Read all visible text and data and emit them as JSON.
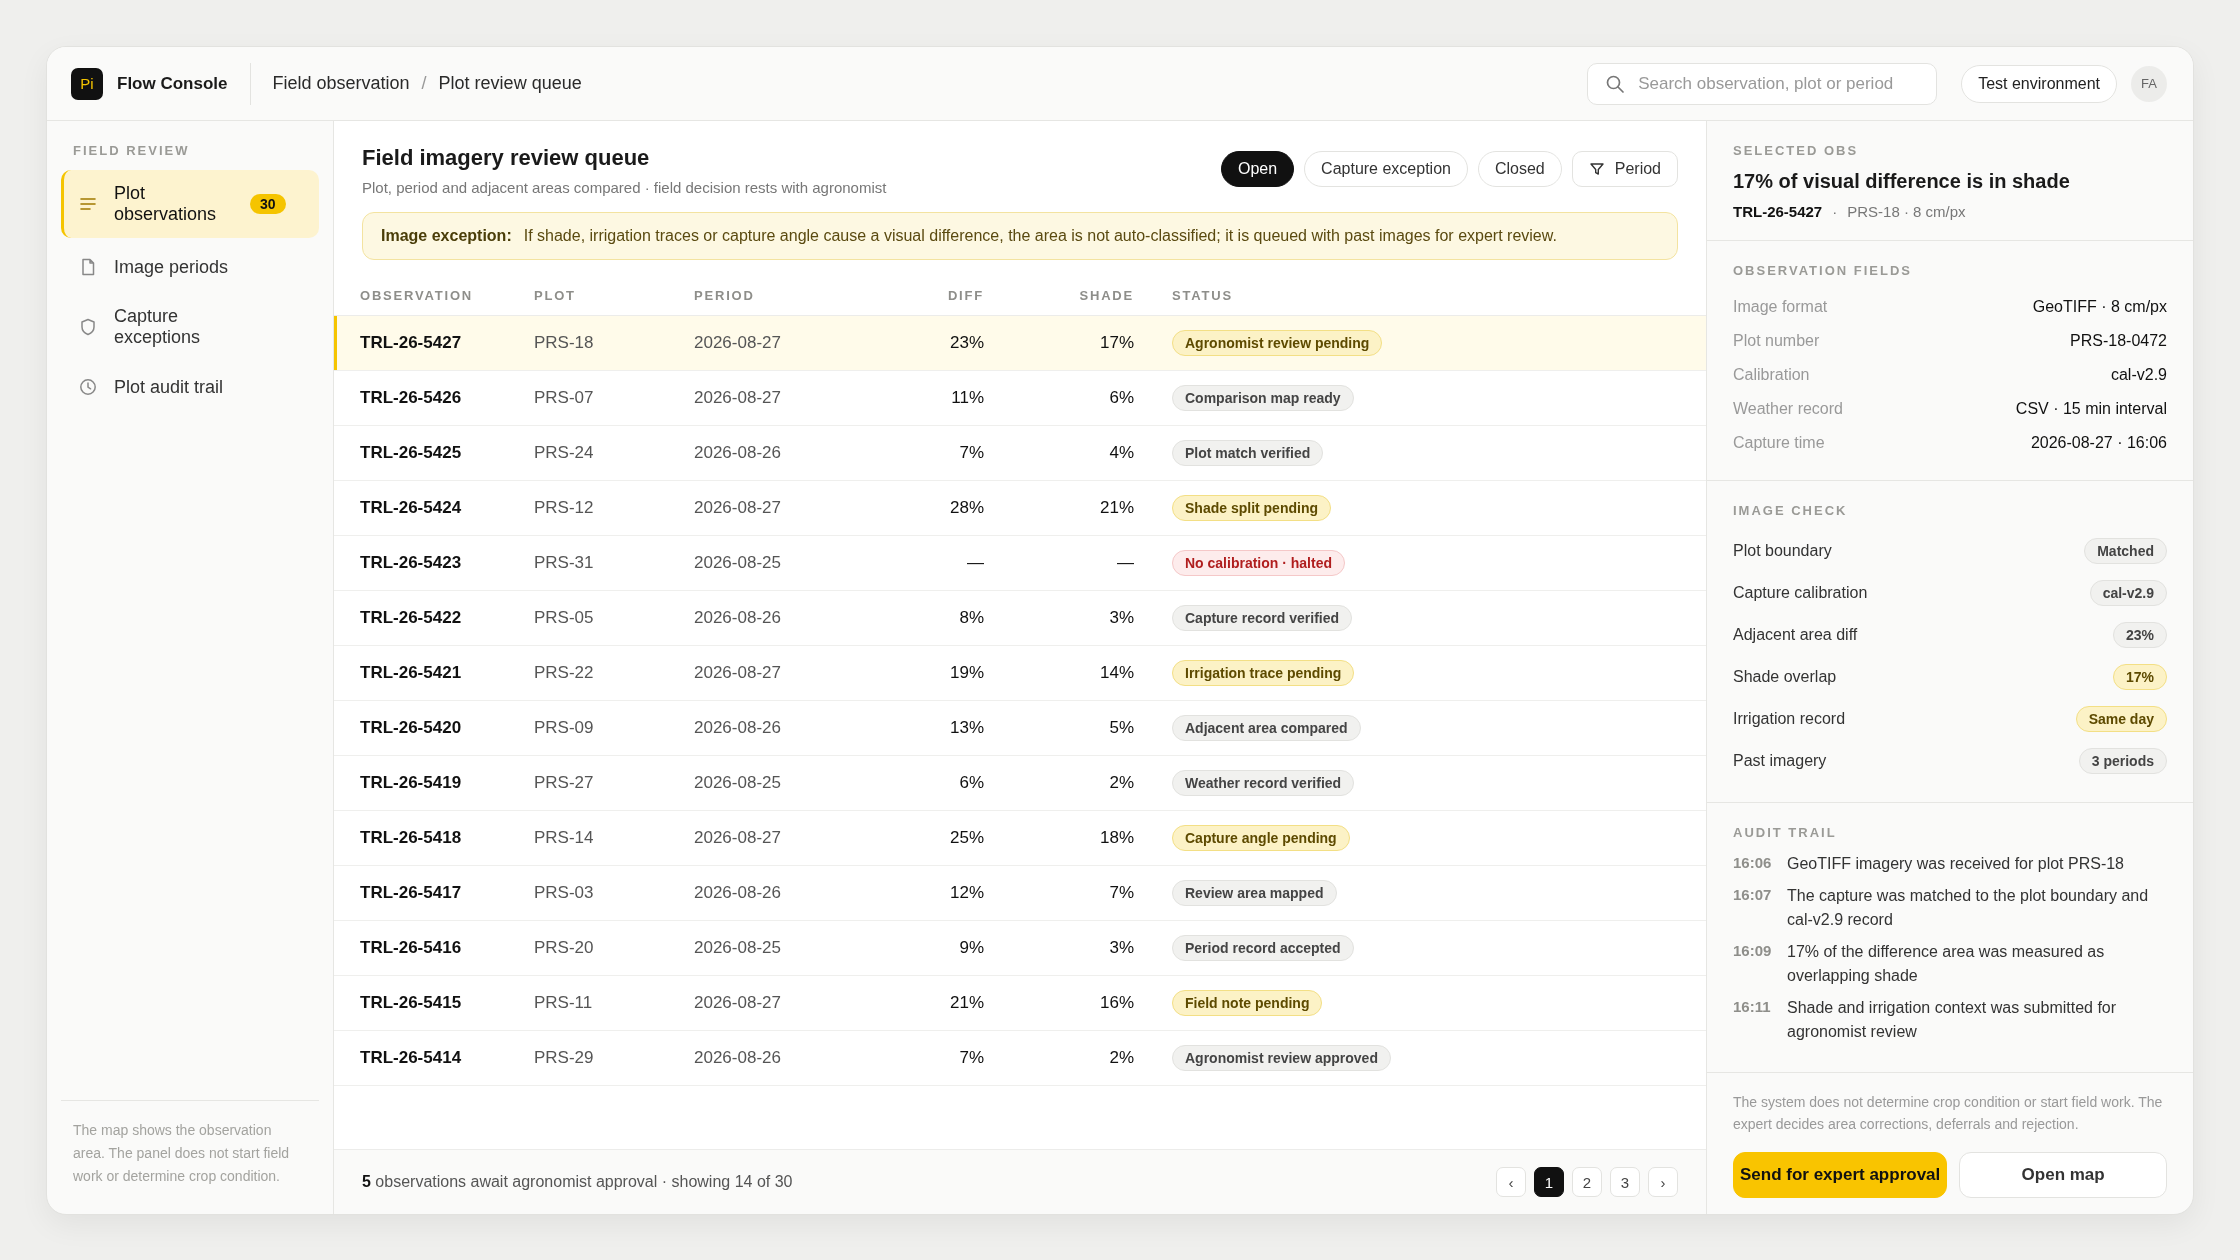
{
  "app": {
    "logo": "Pi",
    "name": "Flow Console"
  },
  "breadcrumb": {
    "items": [
      "Field observation",
      "Plot review queue"
    ],
    "separator": "/"
  },
  "search": {
    "placeholder": "Search observation, plot or period"
  },
  "environment": "Test environment",
  "avatar": "FA",
  "sidebar": {
    "section": "FIELD REVIEW",
    "items": [
      {
        "label": "Plot observations",
        "badge": "30",
        "selected": true
      },
      {
        "label": "Image periods",
        "selected": false
      },
      {
        "label": "Capture exceptions",
        "selected": false
      },
      {
        "label": "Plot audit trail",
        "selected": false
      }
    ],
    "note": "The map shows the observation area. The panel does not start field work or determine crop condition."
  },
  "main": {
    "title": "Field imagery review queue",
    "subtitle": "Plot, period and adjacent areas compared · field decision rests with agronomist",
    "filters": [
      {
        "label": "Open",
        "selected": true,
        "kind": "chip"
      },
      {
        "label": "Capture exception",
        "selected": false,
        "kind": "chip"
      },
      {
        "label": "Closed",
        "selected": false,
        "kind": "chip"
      },
      {
        "label": "Period",
        "selected": false,
        "kind": "filter"
      }
    ],
    "notice": {
      "label": "Image exception:",
      "text": "If shade, irrigation traces or capture angle cause a visual difference, the area is not auto-classified; it is queued with past images for expert review."
    }
  },
  "table": {
    "columns": [
      "OBSERVATION",
      "PLOT",
      "PERIOD",
      "DIFF",
      "SHADE",
      "STATUS"
    ],
    "rows": [
      {
        "observation": "TRL-26-5427",
        "plot": "PRS-18",
        "period": "2026-08-27",
        "diff": "23%",
        "shade": "17%",
        "status": "Agronomist review pending",
        "kind": "warn",
        "selected": true
      },
      {
        "observation": "TRL-26-5426",
        "plot": "PRS-07",
        "period": "2026-08-27",
        "diff": "11%",
        "shade": "6%",
        "status": "Comparison map ready",
        "kind": "neutral",
        "selected": false
      },
      {
        "observation": "TRL-26-5425",
        "plot": "PRS-24",
        "period": "2026-08-26",
        "diff": "7%",
        "shade": "4%",
        "status": "Plot match verified",
        "kind": "neutral",
        "selected": false
      },
      {
        "observation": "TRL-26-5424",
        "plot": "PRS-12",
        "period": "2026-08-27",
        "diff": "28%",
        "shade": "21%",
        "status": "Shade split pending",
        "kind": "warn",
        "selected": false
      },
      {
        "observation": "TRL-26-5423",
        "plot": "PRS-31",
        "period": "2026-08-25",
        "diff": "—",
        "shade": "—",
        "status": "No calibration · halted",
        "kind": "error",
        "selected": false
      },
      {
        "observation": "TRL-26-5422",
        "plot": "PRS-05",
        "period": "2026-08-26",
        "diff": "8%",
        "shade": "3%",
        "status": "Capture record verified",
        "kind": "neutral",
        "selected": false
      },
      {
        "observation": "TRL-26-5421",
        "plot": "PRS-22",
        "period": "2026-08-27",
        "diff": "19%",
        "shade": "14%",
        "status": "Irrigation trace pending",
        "kind": "warn",
        "selected": false
      },
      {
        "observation": "TRL-26-5420",
        "plot": "PRS-09",
        "period": "2026-08-26",
        "diff": "13%",
        "shade": "5%",
        "status": "Adjacent area compared",
        "kind": "neutral",
        "selected": false
      },
      {
        "observation": "TRL-26-5419",
        "plot": "PRS-27",
        "period": "2026-08-25",
        "diff": "6%",
        "shade": "2%",
        "status": "Weather record verified",
        "kind": "neutral",
        "selected": false
      },
      {
        "observation": "TRL-26-5418",
        "plot": "PRS-14",
        "period": "2026-08-27",
        "diff": "25%",
        "shade": "18%",
        "status": "Capture angle pending",
        "kind": "warn",
        "selected": false
      },
      {
        "observation": "TRL-26-5417",
        "plot": "PRS-03",
        "period": "2026-08-26",
        "diff": "12%",
        "shade": "7%",
        "status": "Review area mapped",
        "kind": "neutral",
        "selected": false
      },
      {
        "observation": "TRL-26-5416",
        "plot": "PRS-20",
        "period": "2026-08-25",
        "diff": "9%",
        "shade": "3%",
        "status": "Period record accepted",
        "kind": "neutral",
        "selected": false
      },
      {
        "observation": "TRL-26-5415",
        "plot": "PRS-11",
        "period": "2026-08-27",
        "diff": "21%",
        "shade": "16%",
        "status": "Field note pending",
        "kind": "warn",
        "selected": false
      },
      {
        "observation": "TRL-26-5414",
        "plot": "PRS-29",
        "period": "2026-08-26",
        "diff": "7%",
        "shade": "2%",
        "status": "Agronomist review approved",
        "kind": "neutral",
        "selected": false
      }
    ]
  },
  "footer": {
    "summary": "**5** observations await agronomist approval · showing 14 of 30",
    "prev": "‹",
    "next": "›",
    "pages": [
      {
        "label": "1",
        "selected": true
      },
      {
        "label": "2",
        "selected": false
      },
      {
        "label": "3",
        "selected": false
      }
    ]
  },
  "detail": {
    "section": "SELECTED OBS",
    "title": "17% of visual difference is in shade",
    "id": "TRL-26-5427",
    "separator": "·",
    "meta": "PRS-18 · 8 cm/px",
    "fields_title": "OBSERVATION FIELDS",
    "fields": [
      {
        "label": "Image format",
        "value": "GeoTIFF · 8 cm/px"
      },
      {
        "label": "Plot number",
        "value": "PRS-18-0472"
      },
      {
        "label": "Calibration",
        "value": "cal-v2.9"
      },
      {
        "label": "Weather record",
        "value": "CSV · 15 min interval"
      },
      {
        "label": "Capture time",
        "value": "2026-08-27 · 16:06"
      }
    ],
    "check_title": "IMAGE CHECK",
    "checks": [
      {
        "label": "Plot boundary",
        "value": "Matched",
        "kind": "neutral"
      },
      {
        "label": "Capture calibration",
        "value": "cal-v2.9",
        "kind": "neutral"
      },
      {
        "label": "Adjacent area diff",
        "value": "23%",
        "kind": "neutral"
      },
      {
        "label": "Shade overlap",
        "value": "17%",
        "kind": "warn"
      },
      {
        "label": "Irrigation record",
        "value": "Same day",
        "kind": "warn"
      },
      {
        "label": "Past imagery",
        "value": "3 periods",
        "kind": "neutral"
      }
    ],
    "audit_title": "AUDIT TRAIL",
    "audit": [
      {
        "time": "16:06",
        "text": "GeoTIFF imagery was received for plot PRS-18"
      },
      {
        "time": "16:07",
        "text": "The capture was matched to the plot boundary and cal-v2.9 record"
      },
      {
        "time": "16:09",
        "text": "17% of the difference area was measured as overlapping shade"
      },
      {
        "time": "16:11",
        "text": "Shade and irrigation context was submitted for agronomist review"
      }
    ],
    "note": "The system does not determine crop condition or start field work. The expert decides area corrections, deferrals and rejection.",
    "primary": "Send for expert approval",
    "secondary": "Open map"
  }
}
